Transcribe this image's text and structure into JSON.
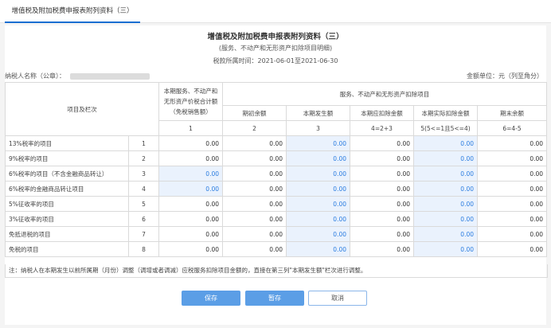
{
  "tab": {
    "label": "增值税及附加税费申报表附列资料（三）"
  },
  "form": {
    "title": "增值税及附加税费申报表附列资料（三）",
    "subtitle": "(服务、不动产和无形资产扣除项目明细)",
    "period": "税款所属时间：2021-06-01至2021-06-30",
    "taxpayer_label": "纳税人名称（公章）：",
    "unit": "金额单位：元（列至角分）"
  },
  "header": {
    "item_col": "项目及栏次",
    "col1_title": "本期服务、不动产和无形资产价税合计额（免税销售额）",
    "deduction_group": "服务、不动产和无形资产扣除项目",
    "col2": "期初余额",
    "col3": "本期发生额",
    "col4": "本期应扣除金额",
    "col5": "本期实际扣除金额",
    "col6": "期末余额",
    "n1": "1",
    "n2": "2",
    "n3": "3",
    "n4": "4=2+3",
    "n5": "5(5<=1且5<=4)",
    "n6": "6=4-5"
  },
  "rows": [
    {
      "name": "13%税率的项目",
      "no": "1",
      "c1": "0.00",
      "c2": "0.00",
      "c3": "0.00",
      "c4": "0.00",
      "c5": "0.00",
      "c6": "0.00"
    },
    {
      "name": "9%税率的项目",
      "no": "2",
      "c1": "0.00",
      "c2": "0.00",
      "c3": "0.00",
      "c4": "0.00",
      "c5": "0.00",
      "c6": "0.00"
    },
    {
      "name": "6%税率的项目（不含金融商品转让）",
      "no": "3",
      "c1": "0.00",
      "c2": "0.00",
      "c3": "0.00",
      "c4": "0.00",
      "c5": "0.00",
      "c6": "0.00"
    },
    {
      "name": "6%税率的金融商品转让项目",
      "no": "4",
      "c1": "0.00",
      "c2": "0.00",
      "c3": "0.00",
      "c4": "0.00",
      "c5": "0.00",
      "c6": "0.00"
    },
    {
      "name": "5%征收率的项目",
      "no": "5",
      "c1": "0.00",
      "c2": "0.00",
      "c3": "0.00",
      "c4": "0.00",
      "c5": "0.00",
      "c6": "0.00"
    },
    {
      "name": "3%征收率的项目",
      "no": "6",
      "c1": "0.00",
      "c2": "0.00",
      "c3": "0.00",
      "c4": "0.00",
      "c5": "0.00",
      "c6": "0.00"
    },
    {
      "name": "免抵退税的项目",
      "no": "7",
      "c1": "0.00",
      "c2": "0.00",
      "c3": "0.00",
      "c4": "0.00",
      "c5": "0.00",
      "c6": "0.00"
    },
    {
      "name": "免税的项目",
      "no": "8",
      "c1": "0.00",
      "c2": "0.00",
      "c3": "0.00",
      "c4": "0.00",
      "c5": "0.00",
      "c6": "0.00"
    }
  ],
  "note": "注：纳税人在本期发生以前所属期（月份）调整（调增或者调减）应税服务扣除项目金额的，直接在第三列\"本期发生额\"栏次进行调整。",
  "buttons": {
    "save": "保存",
    "draft": "暂存",
    "cancel": "取消"
  }
}
